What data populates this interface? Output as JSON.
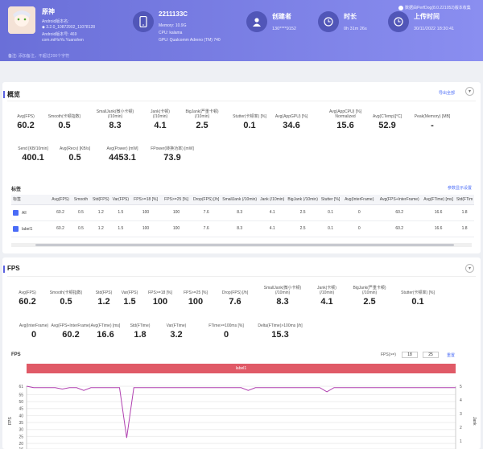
{
  "header": {
    "app_name": "原神",
    "app_lines": [
      "Android版本名:",
      "◆ 3.2.0_10872902_11078128",
      "Android版本号: 469",
      "com.miHoYo.Yuanshen"
    ],
    "note_label": "备注:",
    "note_placeholder": "添加备注，不超过200个字符",
    "device": {
      "title": "2211133C",
      "lines": [
        "Memory: 10.9G",
        "CPU: kalama",
        "GPU: Qualcomm Adreno (TM) 740"
      ]
    },
    "creator": {
      "title": "创建者",
      "value": "130****9152"
    },
    "duration": {
      "title": "时长",
      "value": "0h 31m 26s"
    },
    "upload": {
      "title": "上传时间",
      "value": "30/11/2022 18:30:41"
    },
    "data_source": "数据由PerfDog(8.0.221052)版本收集"
  },
  "overview": {
    "title": "概览",
    "export": "导出全部",
    "metrics_row1": [
      {
        "label": "Avg(FPS)",
        "value": "60.2"
      },
      {
        "label": "Smooth(卡顿指数)",
        "value": "0.5"
      },
      {
        "label": "SmallJank(微小卡顿)\n(/10min)",
        "value": "8.3"
      },
      {
        "label": "Jank(卡顿)\n(/10min)",
        "value": "4.1"
      },
      {
        "label": "BigJank(严重卡顿)\n(/10min)",
        "value": "2.5"
      },
      {
        "label": "Stutter(卡顿率) [%]",
        "value": "0.1"
      },
      {
        "label": "Avg(AppGPU) [%]",
        "value": "34.6"
      },
      {
        "label": "Avg(AppCPU) [%]\nNormalized",
        "value": "15.6"
      },
      {
        "label": "Avg(CTemp)[°C]",
        "value": "52.9"
      },
      {
        "label": "Peak(Memory) [MB]",
        "value": "-"
      }
    ],
    "metrics_row2": [
      {
        "label": "Send [KB/10min]",
        "value": "400.1"
      },
      {
        "label": "Avg(Recv) [KB/s]",
        "value": "0.5"
      },
      {
        "label": "Avg(Power) [mW]",
        "value": "4453.1"
      },
      {
        "label": "FPower(转换功率) [mW]",
        "value": "73.9"
      }
    ],
    "label_section": "标签",
    "label_link": "参数显示设置",
    "table": {
      "headers": [
        "标签",
        "Avg(FPS)",
        "Smooth",
        "Std(FPS)",
        "Var(FPS)",
        "FPS>=18 [%]",
        "FPS>=25 [%]",
        "Drop(FPS) [/h]",
        "SmallJank\n(/10min)",
        "Jank\n(/10min)",
        "BigJank\n(/10min)",
        "Stutter [%]",
        "Avg(InterFrame)",
        "Avg(FPS+InterFrame)",
        "Avg(FTime) [ms]",
        "Std(FTim"
      ],
      "rows": [
        [
          "All",
          "60.2",
          "0.5",
          "1.2",
          "1.5",
          "100",
          "100",
          "7.6",
          "8.3",
          "4.1",
          "2.5",
          "0.1",
          "0",
          "60.2",
          "16.6",
          "1.8"
        ],
        [
          "label1",
          "60.2",
          "0.5",
          "1.2",
          "1.5",
          "100",
          "100",
          "7.6",
          "8.3",
          "4.1",
          "2.5",
          "0.1",
          "0",
          "60.2",
          "16.6",
          "1.8"
        ]
      ]
    }
  },
  "fps_section": {
    "title": "FPS",
    "metrics_row1": [
      {
        "label": "Avg(FPS)",
        "value": "60.2"
      },
      {
        "label": "Smooth(卡顿指数)",
        "value": "0.5"
      },
      {
        "label": "Std(FPS)",
        "value": "1.2"
      },
      {
        "label": "Var(FPS)",
        "value": "1.5"
      },
      {
        "label": "FPS>=18 [%]",
        "value": "100"
      },
      {
        "label": "FPS>=25 [%]",
        "value": "100"
      },
      {
        "label": "Drop(FPS) [/h]",
        "value": "7.6"
      },
      {
        "label": "SmallJank(微小卡顿)\n(/10min)",
        "value": "8.3"
      },
      {
        "label": "Jank(卡顿)\n(/10min)",
        "value": "4.1"
      },
      {
        "label": "BigJank(严重卡顿)\n(/10min)",
        "value": "2.5"
      },
      {
        "label": "Stutter(卡顿率) [%]",
        "value": "0.1"
      }
    ],
    "metrics_row2": [
      {
        "label": "Avg(InterFrame)",
        "value": "0"
      },
      {
        "label": "Avg(FPS+InterFrame)",
        "value": "60.2"
      },
      {
        "label": "Avg(FTime) [ms]",
        "value": "16.6"
      },
      {
        "label": "Std(FTime)",
        "value": "1.8"
      },
      {
        "label": "Var(FTime)",
        "value": "3.2"
      },
      {
        "label": "FTime>=100ms [%]",
        "value": "0"
      },
      {
        "label": "Delta(FTime)>100ms [/h]",
        "value": "15.3"
      }
    ],
    "chart_label": "FPS",
    "filter_label": "FPS(>=)",
    "filter_low": "18",
    "filter_high": "25",
    "reset": "重置",
    "band_label": "label1"
  },
  "chart_data": {
    "type": "line",
    "series": [
      {
        "name": "FPS",
        "color": "#b040b0",
        "values": [
          61,
          60,
          60,
          60,
          60,
          59,
          60,
          60,
          58,
          60,
          60,
          60,
          60,
          60,
          24,
          60,
          60,
          60,
          60,
          60,
          60,
          60,
          60,
          60,
          60,
          60,
          60,
          60,
          60,
          60,
          60,
          58,
          60,
          60,
          60,
          60,
          60,
          60,
          60,
          60,
          60,
          60,
          57,
          60,
          60,
          60,
          60,
          60,
          60,
          60,
          60,
          60,
          60,
          60,
          60,
          60,
          60,
          60,
          60,
          60,
          60
        ]
      }
    ],
    "ylim": [
      16,
      61
    ],
    "left_ticks": [
      "61",
      "55",
      "50",
      "45",
      "40",
      "35",
      "30",
      "25",
      "20",
      "16"
    ],
    "right_ticks": [
      "5",
      "4",
      "3",
      "2",
      "1"
    ],
    "ylabel_left": "FPS",
    "ylabel_right": "Jank"
  }
}
